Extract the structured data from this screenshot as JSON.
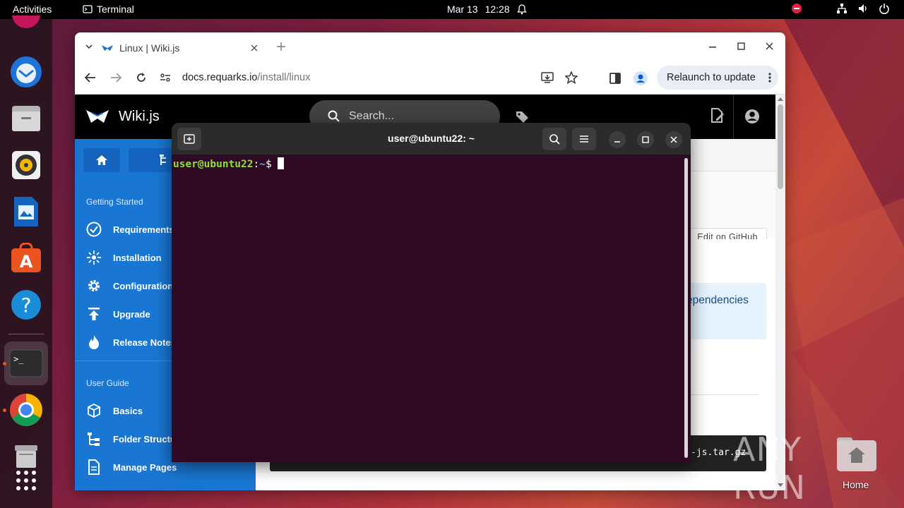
{
  "topbar": {
    "activities": "Activities",
    "app_name": "Terminal",
    "date": "Mar 13",
    "time": "12:28"
  },
  "dock": {
    "items": [
      "thunderbird-icon",
      "files-icon",
      "rhythmbox-icon",
      "writer-icon",
      "software-icon",
      "help-icon",
      "terminal-icon",
      "chrome-icon",
      "trash-icon",
      "apps-grid-icon"
    ]
  },
  "browser": {
    "tab_title": "Linux | Wiki.js",
    "url_domain": "docs.requarks.io",
    "url_path": "/install/linux",
    "relaunch_label": "Relaunch to update"
  },
  "wiki": {
    "site_name": "Wiki.js",
    "search_placeholder": "Search...",
    "section_getting_started": "Getting Started",
    "nav": [
      "Requirements",
      "Installation",
      "Configuration",
      "Upgrade",
      "Release Notes"
    ],
    "section_user_guide": "User Guide",
    "nav2": [
      "Basics",
      "Folder Structu",
      "Manage Pages"
    ],
    "edit_github": "Edit on GitHub",
    "dependencies_text": "ependencies",
    "code_snippet": "-js.tar.gz"
  },
  "terminal": {
    "title": "user@ubuntu22: ~",
    "prompt_user": "user@ubuntu22",
    "prompt_sep": ":",
    "prompt_path": "~",
    "prompt_symbol": "$ "
  },
  "desktop": {
    "home_label": "Home",
    "watermark": "ANY RUN"
  },
  "colors": {
    "accent": "#e95420",
    "wiki_blue": "#1976d2",
    "terminal_bg": "#300a24",
    "prompt_green": "#8ae234",
    "prompt_blue": "#729fcf"
  }
}
